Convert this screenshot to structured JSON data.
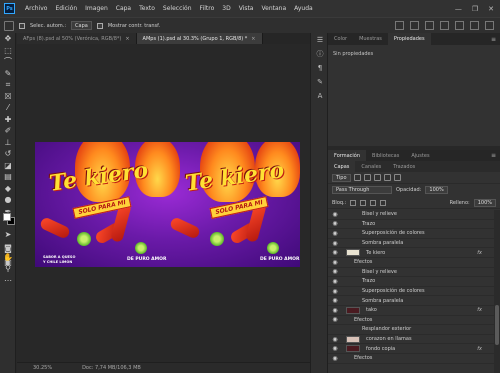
{
  "menu": {
    "logo": "Ps",
    "items": [
      "Archivo",
      "Edición",
      "Imagen",
      "Capa",
      "Texto",
      "Selección",
      "Filtro",
      "3D",
      "Vista",
      "Ventana",
      "Ayuda"
    ],
    "window_controls": [
      "—",
      "❐",
      "✕"
    ]
  },
  "options": {
    "autoselect_label": "Selec. autom.:",
    "autoselect_value": "Capa",
    "transform_label": "Mostrar contr. transf."
  },
  "doc_tabs": [
    {
      "label": "AFps (8).psd al 50% (Verónica, RGB/8*)",
      "close": "×"
    },
    {
      "label": "AMps (1).psd al 30.3% (Grupo 1, RGB/8) *",
      "close": "×"
    }
  ],
  "artwork": {
    "brand_left": "Te kiero",
    "brand_right": "Te kiero",
    "ribbon_left": "SOLO PARA MI",
    "ribbon_right": "SOLO PARA MI",
    "claim_left_1": "SABOR A QUESO",
    "claim_left_2": "Y CHILE LIMÓN",
    "claim_right_1": "DE PURO AMOR",
    "claim_right_2": "DE PURO AMOR"
  },
  "status": {
    "zoom": "30.25%",
    "doc_size": "Doc: 7,74 MB/106,3 MB"
  },
  "props_panel": {
    "tabs": [
      "Color",
      "Muestras",
      "Propiedades"
    ],
    "active_tab": "Propiedades",
    "content": "Sin propiedades"
  },
  "layers_panel": {
    "tabs": [
      "Formación",
      "Bibliotecas",
      "Ajustes"
    ],
    "active_tab": "Formación",
    "sub_tabs": [
      "Capas",
      "Canales",
      "Trazados"
    ],
    "filter_value": "Tipo",
    "blend_mode": "Pass Through",
    "opacity_label": "Opacidad:",
    "opacity_value": "100%",
    "lock_label": "Bloq.:",
    "fill_label": "Relleno:",
    "fill_value": "100%",
    "layers": [
      {
        "name": "Bisel y relieve",
        "indent": 2,
        "eye": true,
        "thumb": false,
        "fx": false
      },
      {
        "name": "Trazo",
        "indent": 2,
        "eye": true,
        "thumb": false,
        "fx": false
      },
      {
        "name": "Superposición de colores",
        "indent": 2,
        "eye": true,
        "thumb": false,
        "fx": false
      },
      {
        "name": "Sombra paralela",
        "indent": 2,
        "eye": true,
        "thumb": false,
        "fx": false
      },
      {
        "name": "Te kiero",
        "indent": 0,
        "eye": true,
        "thumb": true,
        "fx": true
      },
      {
        "name": "Efectos",
        "indent": 1,
        "eye": true,
        "thumb": false,
        "fx": false
      },
      {
        "name": "Bisel y relieve",
        "indent": 2,
        "eye": true,
        "thumb": false,
        "fx": false
      },
      {
        "name": "Trazo",
        "indent": 2,
        "eye": true,
        "thumb": false,
        "fx": false
      },
      {
        "name": "Superposición de colores",
        "indent": 2,
        "eye": true,
        "thumb": false,
        "fx": false
      },
      {
        "name": "Sombra paralela",
        "indent": 2,
        "eye": true,
        "thumb": false,
        "fx": false
      },
      {
        "name": "tako",
        "indent": 0,
        "eye": true,
        "thumb": true,
        "fx": true
      },
      {
        "name": "Efectos",
        "indent": 1,
        "eye": true,
        "thumb": false,
        "fx": false
      },
      {
        "name": "Resplandor exterior",
        "indent": 2,
        "eye": false,
        "thumb": false,
        "fx": false
      },
      {
        "name": "corazon en llamas",
        "indent": 0,
        "eye": true,
        "thumb": true,
        "fx": false
      },
      {
        "name": "fondo copia",
        "indent": 0,
        "eye": true,
        "thumb": true,
        "fx": true
      },
      {
        "name": "Efectos",
        "indent": 1,
        "eye": true,
        "thumb": false,
        "fx": false
      }
    ]
  },
  "colors": {
    "accent": "#31a8ff",
    "panel_bg": "#323232",
    "artwork_purple": "#6a1aa8",
    "brand_yellow": "#ffe033",
    "brand_red": "#c21d14"
  }
}
